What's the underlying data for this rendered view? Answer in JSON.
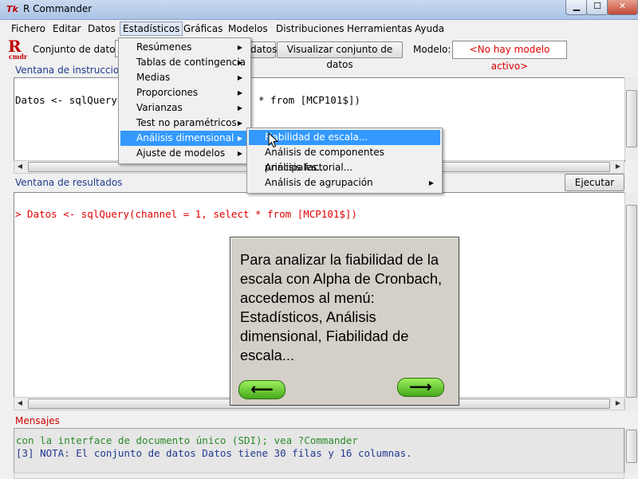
{
  "window": {
    "title": "R Commander",
    "app_icon": "Tk",
    "minimize": "▁",
    "maximize": "☐",
    "close": "✕"
  },
  "menubar": [
    "Fichero",
    "Editar",
    "Datos",
    "Estadísticos",
    "Gráficas",
    "Modelos",
    "Distribuciones",
    "Herramientas",
    "Ayuda"
  ],
  "toolbar": {
    "logo": "R",
    "logo_sub": "cmdr",
    "dataset_label": "Conjunto de datos:",
    "edit_data_fragment": "datos",
    "view_data": "Visualizar conjunto de datos",
    "model_label": "Modelo:",
    "model_value": "<No hay modelo activo>"
  },
  "script": {
    "label": "Ventana de instrucciones",
    "line_left": "Datos <- sqlQuery",
    "line_right": "* from [MCP101$])"
  },
  "output": {
    "label": "Ventana de resultados",
    "run_button": "Ejecutar",
    "line": "> Datos <- sqlQuery(channel = 1, select * from [MCP101$])"
  },
  "stats_menu": [
    {
      "label": "Resúmenes",
      "submenu": true
    },
    {
      "label": "Tablas de contingencia",
      "submenu": true
    },
    {
      "label": "Medias",
      "submenu": true
    },
    {
      "label": "Proporciones",
      "submenu": true
    },
    {
      "label": "Varianzas",
      "submenu": true
    },
    {
      "label": "Test no paramétricos",
      "submenu": true
    },
    {
      "label": "Análisis dimensional",
      "submenu": true,
      "selected": true
    },
    {
      "label": "Ajuste de modelos",
      "submenu": true
    }
  ],
  "dimensional_submenu": [
    {
      "label": "Fiabilidad de escala...",
      "submenu": false,
      "selected": true
    },
    {
      "label": "Análisis de componentes principales...",
      "submenu": false
    },
    {
      "label": "Análisis factorial...",
      "submenu": false
    },
    {
      "label": "Análisis de agrupación",
      "submenu": true
    }
  ],
  "tooltip": {
    "text": "Para analizar la fiabilidad de la escala con Alpha de Cronbach, accedemos al menú: Estadísticos, Análisis dimensional, Fiabilidad de escala...",
    "back": "⟵",
    "next": "⟶"
  },
  "messages": {
    "label": "Mensajes",
    "line1": "con la interface de documento único (SDI); vea ?Commander",
    "line2": "[3] NOTA: El conjunto de datos Datos tiene 30 filas y 16 columnas."
  },
  "colors": {
    "selection": "#3399ff",
    "error_text": "#e00000",
    "message_text": "#2a8a2a",
    "note_text": "#1f3a8f",
    "label_blue": "#1f3a8f"
  }
}
